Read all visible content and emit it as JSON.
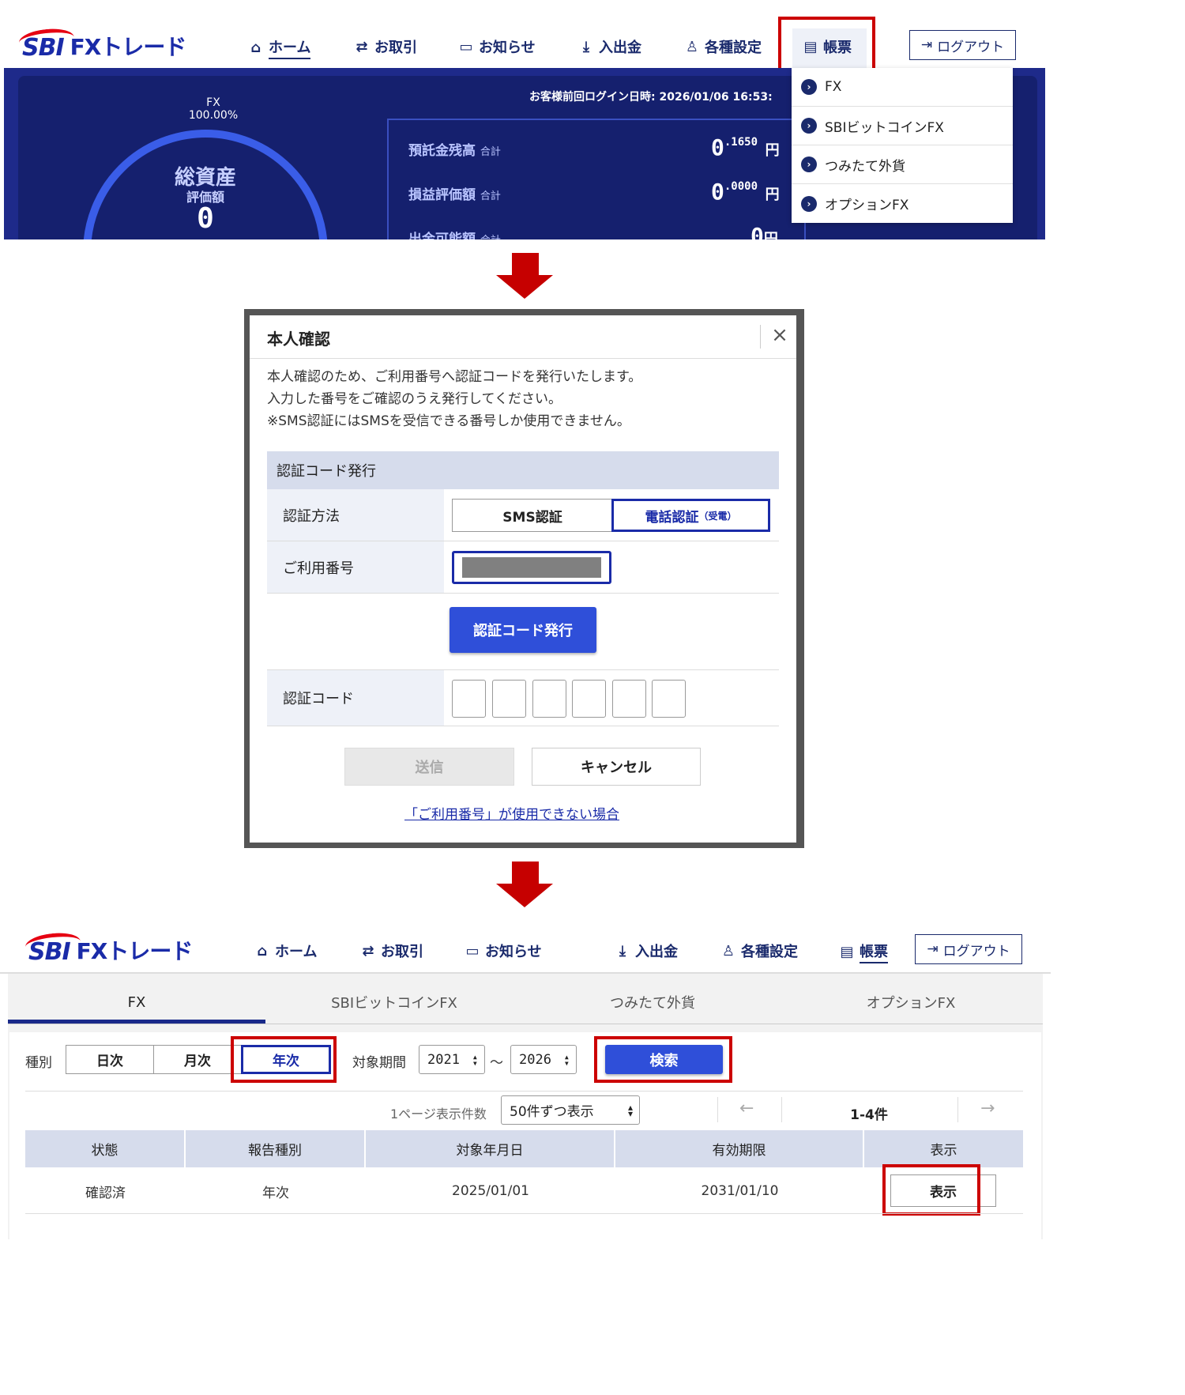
{
  "brand": {
    "sbi": "SBI",
    "fx": "FXトレード"
  },
  "nav": {
    "home": "ホーム",
    "trade": "お取引",
    "news": "お知らせ",
    "deposit": "入出金",
    "settings": "各種設定",
    "reports": "帳票",
    "logout": "ログアウト"
  },
  "dashboard": {
    "fx_label": "FX",
    "fx_percent": "100.00%",
    "total_assets": "総資産",
    "evaluation": "評価額",
    "total_value": "0",
    "last_login": "お客様前回ログイン日時: 2026/01/06 16:53:",
    "rows": [
      {
        "label": "預託金残高",
        "suffix": "合計",
        "value": "0",
        "decimal": ".1650",
        "unit": "円"
      },
      {
        "label": "損益評価額",
        "suffix": "合計",
        "value": "0",
        "decimal": ".0000",
        "unit": "円"
      },
      {
        "label": "出金可能額",
        "suffix": "合計",
        "value": "0",
        "decimal": "",
        "unit": "円"
      }
    ]
  },
  "report_menu": [
    "FX",
    "SBIビットコインFX",
    "つみたて外貨",
    "オプションFX"
  ],
  "modal": {
    "title": "本人確認",
    "close": "×",
    "text": [
      "本人確認のため、ご利用番号へ認証コードを発行いたします。",
      "入力した番号をご確認のうえ発行してください。",
      "※SMS認証にはSMSを受信できる番号しか使用できません。"
    ],
    "section": "認証コード発行",
    "method_label": "認証方法",
    "sms": "SMS認証",
    "phone": "電話認証",
    "phone_sub": "（受電）",
    "number_label": "ご利用番号",
    "issue_button": "認証コード発行",
    "code_label": "認証コード",
    "submit": "送信",
    "cancel": "キャンセル",
    "help_link": "「ご利用番号」が使用できない場合"
  },
  "reports": {
    "tabs": [
      "FX",
      "SBIビットコインFX",
      "つみたて外貨",
      "オプションFX"
    ],
    "type_label": "種別",
    "types": [
      "日次",
      "月次",
      "年次"
    ],
    "period_label": "対象期間",
    "from_year": "2021",
    "tilde": "～",
    "to_year": "2026",
    "search": "検索",
    "per_page_label": "1ページ表示件数",
    "per_page_value": "50件ずつ表示",
    "prev": "←",
    "count": "1-4件",
    "next": "→",
    "columns": [
      "状態",
      "報告種別",
      "対象年月日",
      "有効期限",
      "表示"
    ],
    "row": {
      "status": "確認済",
      "kind": "年次",
      "date": "2025/01/01",
      "expiry": "2031/01/10",
      "view": "表示"
    }
  },
  "colors": {
    "brand_blue": "#1a2ba8",
    "highlight_red": "#cc0000",
    "arrow_red": "#c60000",
    "dashboard": "#1e2a8a"
  }
}
